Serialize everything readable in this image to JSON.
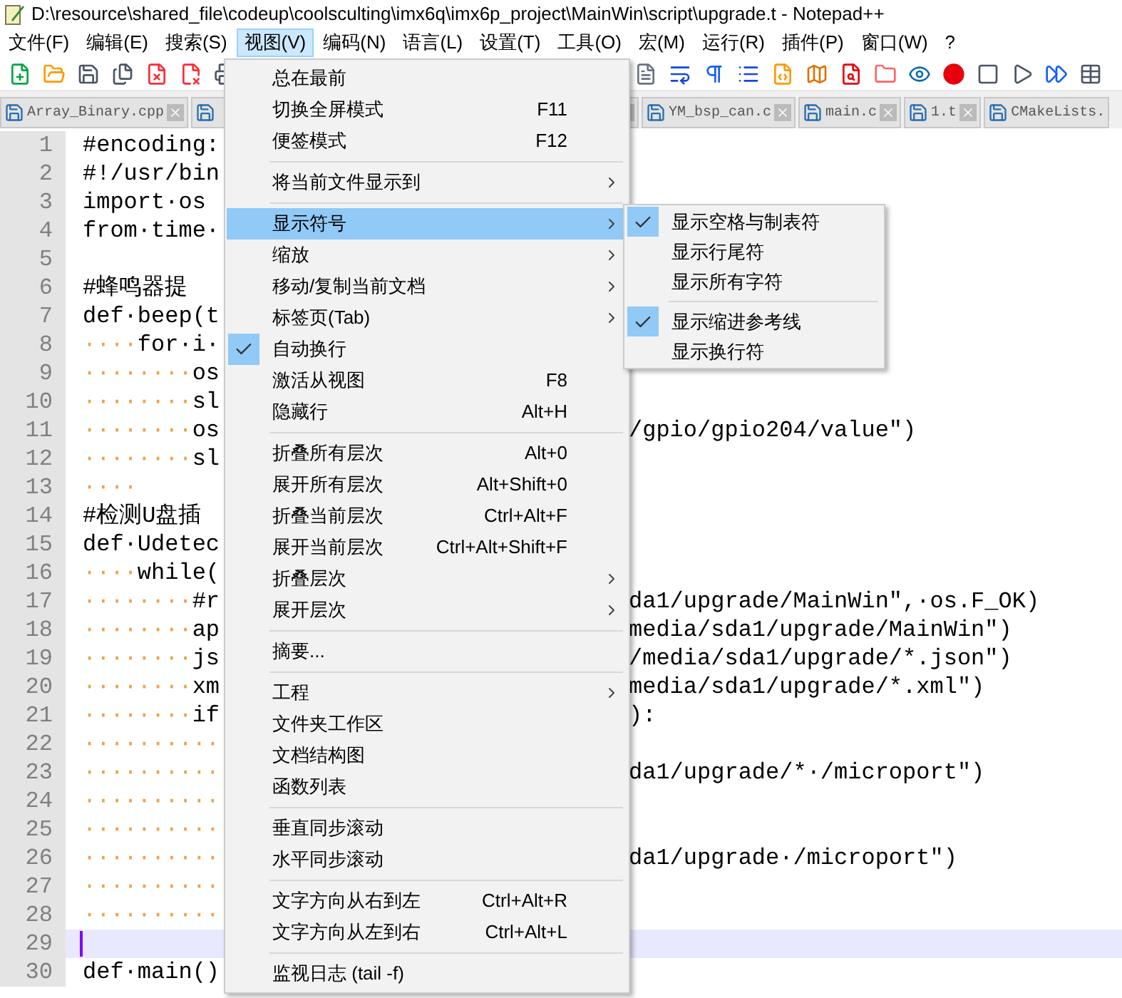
{
  "window": {
    "title": "D:\\resource\\shared_file\\codeup\\coolsculting\\imx6q\\imx6p_project\\MainWin\\script\\upgrade.t - Notepad++"
  },
  "menubar": [
    {
      "label": "文件(F)",
      "selected": false
    },
    {
      "label": "编辑(E)",
      "selected": false
    },
    {
      "label": "搜索(S)",
      "selected": false
    },
    {
      "label": "视图(V)",
      "selected": true
    },
    {
      "label": "编码(N)",
      "selected": false
    },
    {
      "label": "语言(L)",
      "selected": false
    },
    {
      "label": "设置(T)",
      "selected": false
    },
    {
      "label": "工具(O)",
      "selected": false
    },
    {
      "label": "宏(M)",
      "selected": false
    },
    {
      "label": "运行(R)",
      "selected": false
    },
    {
      "label": "插件(P)",
      "selected": false
    },
    {
      "label": "窗口(W)",
      "selected": false
    },
    {
      "label": "?",
      "selected": false
    }
  ],
  "tabs": [
    {
      "kind": "full",
      "label": "Array_Binary.cpp",
      "selected": false
    },
    {
      "kind": "covered",
      "selected": false
    },
    {
      "kind": "full",
      "label": "YM_bsp_can.c",
      "selected": false
    },
    {
      "kind": "full",
      "label": "main.c",
      "selected": false
    },
    {
      "kind": "full",
      "label": "1.t",
      "selected": false
    },
    {
      "kind": "cut",
      "label": "CMakeLists.",
      "selected": false
    }
  ],
  "editor": {
    "lines": [
      {
        "number": "1",
        "text": "#encoding:",
        "current": false
      },
      {
        "number": "2",
        "text": "#!/usr/bin",
        "current": false
      },
      {
        "number": "3",
        "text": "import·os",
        "current": false
      },
      {
        "number": "4",
        "text": "from·time·",
        "current": false
      },
      {
        "number": "5",
        "current": false
      },
      {
        "number": "6",
        "text": "#蜂鸣器提",
        "current": false
      },
      {
        "number": "7",
        "text": "def·beep(t",
        "current": false
      },
      {
        "number": "8",
        "indent": "····",
        "text": "for·i·",
        "current": false
      },
      {
        "number": "9",
        "indent": "········",
        "text": "os",
        "current": false
      },
      {
        "number": "10",
        "indent": "········",
        "text": "sl",
        "current": false
      },
      {
        "number": "11",
        "indent": "········",
        "text": "os",
        "tail": "/gpio/gpio204/value\")",
        "current": false
      },
      {
        "number": "12",
        "indent": "········",
        "text": "sl",
        "current": false
      },
      {
        "number": "13",
        "indent": "····",
        "current": false
      },
      {
        "number": "14",
        "text": "#检测U盘插",
        "current": false
      },
      {
        "number": "15",
        "text": "def·Udetec",
        "current": false
      },
      {
        "number": "16",
        "indent": "····",
        "text": "while(",
        "current": false
      },
      {
        "number": "17",
        "indent": "········",
        "text": "#r",
        "tail": "da1/upgrade/MainWin\",·os.F_OK)",
        "current": false
      },
      {
        "number": "18",
        "indent": "········",
        "text": "ap",
        "tail": "media/sda1/upgrade/MainWin\")",
        "current": false
      },
      {
        "number": "19",
        "indent": "········",
        "text": "js",
        "tail": "/media/sda1/upgrade/*.json\")",
        "current": false
      },
      {
        "number": "20",
        "indent": "········",
        "text": "xm",
        "tail": "media/sda1/upgrade/*.xml\")",
        "current": false
      },
      {
        "number": "21",
        "indent": "········",
        "text": "if",
        "tail": "):",
        "current": false
      },
      {
        "number": "22",
        "indent": "··········",
        "current": false
      },
      {
        "number": "23",
        "indent": "··········",
        "tail": "da1/upgrade/*·/microport\")",
        "current": false
      },
      {
        "number": "24",
        "indent": "··········",
        "current": false
      },
      {
        "number": "25",
        "indent": "··········",
        "current": false
      },
      {
        "number": "26",
        "indent": "··········",
        "tail": "da1/upgrade·/microport\")",
        "current": false
      },
      {
        "number": "27",
        "indent": "··········",
        "current": false
      },
      {
        "number": "28",
        "indent": "··········",
        "current": false
      },
      {
        "number": "29",
        "current": true
      },
      {
        "number": "30",
        "text": "def·main()",
        "current": false
      }
    ]
  },
  "view_menu": {
    "items": [
      {
        "kind": "item",
        "label": "总在最前",
        "submenu": false,
        "checked": false,
        "selected": false
      },
      {
        "kind": "item",
        "label": "切换全屏模式",
        "shortcut": "F11",
        "submenu": false,
        "checked": false,
        "selected": false
      },
      {
        "kind": "item",
        "label": "便签模式",
        "shortcut": "F12",
        "submenu": false,
        "checked": false,
        "selected": false
      },
      {
        "kind": "separator"
      },
      {
        "kind": "item",
        "label": "将当前文件显示到",
        "submenu": true,
        "checked": false,
        "selected": false
      },
      {
        "kind": "separator"
      },
      {
        "kind": "item",
        "label": "显示符号",
        "submenu": true,
        "checked": false,
        "selected": true
      },
      {
        "kind": "item",
        "label": "缩放",
        "submenu": true,
        "checked": false,
        "selected": false
      },
      {
        "kind": "item",
        "label": "移动/复制当前文档",
        "submenu": true,
        "checked": false,
        "selected": false
      },
      {
        "kind": "item",
        "label": "标签页(Tab)",
        "submenu": true,
        "checked": false,
        "selected": false
      },
      {
        "kind": "item",
        "label": "自动换行",
        "submenu": false,
        "checked": true,
        "selected": false
      },
      {
        "kind": "item",
        "label": "激活从视图",
        "shortcut": "F8",
        "submenu": false,
        "checked": false,
        "selected": false
      },
      {
        "kind": "item",
        "label": "隐藏行",
        "shortcut": "Alt+H",
        "submenu": false,
        "checked": false,
        "selected": false
      },
      {
        "kind": "separator"
      },
      {
        "kind": "item",
        "label": "折叠所有层次",
        "shortcut": "Alt+0",
        "submenu": false,
        "checked": false,
        "selected": false
      },
      {
        "kind": "item",
        "label": "展开所有层次",
        "shortcut": "Alt+Shift+0",
        "submenu": false,
        "checked": false,
        "selected": false
      },
      {
        "kind": "item",
        "label": "折叠当前层次",
        "shortcut": "Ctrl+Alt+F",
        "submenu": false,
        "checked": false,
        "selected": false
      },
      {
        "kind": "item",
        "label": "展开当前层次",
        "shortcut": "Ctrl+Alt+Shift+F",
        "submenu": false,
        "checked": false,
        "selected": false
      },
      {
        "kind": "item",
        "label": "折叠层次",
        "submenu": true,
        "checked": false,
        "selected": false
      },
      {
        "kind": "item",
        "label": "展开层次",
        "submenu": true,
        "checked": false,
        "selected": false
      },
      {
        "kind": "separator"
      },
      {
        "kind": "item",
        "label": "摘要...",
        "submenu": false,
        "checked": false,
        "selected": false
      },
      {
        "kind": "separator"
      },
      {
        "kind": "item",
        "label": "工程",
        "submenu": true,
        "checked": false,
        "selected": false
      },
      {
        "kind": "item",
        "label": "文件夹工作区",
        "submenu": false,
        "checked": false,
        "selected": false
      },
      {
        "kind": "item",
        "label": "文档结构图",
        "submenu": false,
        "checked": false,
        "selected": false
      },
      {
        "kind": "item",
        "label": "函数列表",
        "submenu": false,
        "checked": false,
        "selected": false
      },
      {
        "kind": "separator"
      },
      {
        "kind": "item",
        "label": "垂直同步滚动",
        "submenu": false,
        "checked": false,
        "selected": false
      },
      {
        "kind": "item",
        "label": "水平同步滚动",
        "submenu": false,
        "checked": false,
        "selected": false
      },
      {
        "kind": "separator"
      },
      {
        "kind": "item",
        "label": "文字方向从右到左",
        "shortcut": "Ctrl+Alt+R",
        "submenu": false,
        "checked": false,
        "selected": false
      },
      {
        "kind": "item",
        "label": "文字方向从左到右",
        "shortcut": "Ctrl+Alt+L",
        "submenu": false,
        "checked": false,
        "selected": false
      },
      {
        "kind": "separator"
      },
      {
        "kind": "item",
        "label": "监视日志 (tail -f)",
        "submenu": false,
        "checked": false,
        "selected": false
      }
    ]
  },
  "symbol_submenu": {
    "items": [
      {
        "kind": "item",
        "label": "显示空格与制表符",
        "submenu": false,
        "checked": true,
        "selected": false
      },
      {
        "kind": "item",
        "label": "显示行尾符",
        "submenu": false,
        "checked": false,
        "selected": false
      },
      {
        "kind": "item",
        "label": "显示所有字符",
        "submenu": false,
        "checked": false,
        "selected": false
      },
      {
        "kind": "separator"
      },
      {
        "kind": "item",
        "label": "显示缩进参考线",
        "submenu": false,
        "checked": true,
        "selected": false
      },
      {
        "kind": "item",
        "label": "显示换行符",
        "submenu": false,
        "checked": false,
        "selected": false
      }
    ]
  }
}
